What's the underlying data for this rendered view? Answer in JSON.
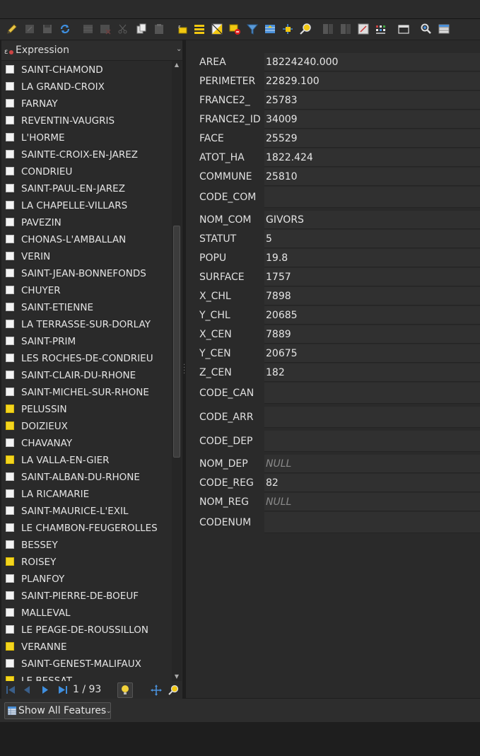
{
  "expression_header": {
    "label": "Expression"
  },
  "toolbar": {
    "icons": [
      "pencil-icon",
      "save-edits-icon",
      "save-icon",
      "reload-icon",
      "add-feature-icon",
      "delete-feature-icon",
      "cut-icon",
      "copy-icon",
      "paste-icon",
      "select-by-expression-icon",
      "select-all-icon",
      "invert-selection-icon",
      "deselect-icon",
      "filter-icon",
      "move-selection-top-icon",
      "pan-to-selection-icon",
      "zoom-to-selection-icon",
      "new-field-icon",
      "delete-field-icon",
      "field-calculator-icon",
      "conditional-formatting-icon",
      "dock-icon",
      "actions-icon",
      "table-view-icon"
    ]
  },
  "features": [
    {
      "name": "SAINT-CHAMOND",
      "selected": false
    },
    {
      "name": "LA GRAND-CROIX",
      "selected": false
    },
    {
      "name": "FARNAY",
      "selected": false
    },
    {
      "name": "REVENTIN-VAUGRIS",
      "selected": false
    },
    {
      "name": "L'HORME",
      "selected": false
    },
    {
      "name": "SAINTE-CROIX-EN-JAREZ",
      "selected": false
    },
    {
      "name": "CONDRIEU",
      "selected": false
    },
    {
      "name": "SAINT-PAUL-EN-JAREZ",
      "selected": false
    },
    {
      "name": "LA CHAPELLE-VILLARS",
      "selected": false
    },
    {
      "name": "PAVEZIN",
      "selected": false
    },
    {
      "name": "CHONAS-L'AMBALLAN",
      "selected": false
    },
    {
      "name": "VERIN",
      "selected": false
    },
    {
      "name": "SAINT-JEAN-BONNEFONDS",
      "selected": false
    },
    {
      "name": "CHUYER",
      "selected": false
    },
    {
      "name": "SAINT-ETIENNE",
      "selected": false
    },
    {
      "name": "LA TERRASSE-SUR-DORLAY",
      "selected": false
    },
    {
      "name": "SAINT-PRIM",
      "selected": false
    },
    {
      "name": "LES ROCHES-DE-CONDRIEU",
      "selected": false
    },
    {
      "name": "SAINT-CLAIR-DU-RHONE",
      "selected": false
    },
    {
      "name": "SAINT-MICHEL-SUR-RHONE",
      "selected": false
    },
    {
      "name": "PELUSSIN",
      "selected": true
    },
    {
      "name": "DOIZIEUX",
      "selected": true
    },
    {
      "name": "CHAVANAY",
      "selected": false
    },
    {
      "name": "LA VALLA-EN-GIER",
      "selected": true
    },
    {
      "name": "SAINT-ALBAN-DU-RHONE",
      "selected": false
    },
    {
      "name": "LA RICAMARIE",
      "selected": false
    },
    {
      "name": "SAINT-MAURICE-L'EXIL",
      "selected": false
    },
    {
      "name": "LE CHAMBON-FEUGEROLLES",
      "selected": false
    },
    {
      "name": "BESSEY",
      "selected": false
    },
    {
      "name": "ROISEY",
      "selected": true
    },
    {
      "name": "PLANFOY",
      "selected": false
    },
    {
      "name": "SAINT-PIERRE-DE-BOEUF",
      "selected": false
    },
    {
      "name": "MALLEVAL",
      "selected": false
    },
    {
      "name": "LE PEAGE-DE-ROUSSILLON",
      "selected": false
    },
    {
      "name": "VERANNE",
      "selected": true
    },
    {
      "name": "SAINT-GENEST-MALIFAUX",
      "selected": false
    },
    {
      "name": "LE BESSAT",
      "selected": true
    }
  ],
  "navigation": {
    "page_indicator": "1 / 93"
  },
  "attributes": [
    {
      "label": "AREA",
      "value": "18224240.000"
    },
    {
      "label": "PERIMETER",
      "value": "22829.100"
    },
    {
      "label": "FRANCE2_",
      "value": "25783"
    },
    {
      "label": "FRANCE2_ID",
      "value": "34009"
    },
    {
      "label": "FACE",
      "value": "25529"
    },
    {
      "label": "ATOT_HA",
      "value": "1822.424"
    },
    {
      "label": "COMMUNE",
      "value": "25810"
    },
    {
      "label": "CODE_COM",
      "value": ""
    },
    {
      "label": "NOM_COM",
      "value": "GIVORS"
    },
    {
      "label": "STATUT",
      "value": "5"
    },
    {
      "label": "POPU",
      "value": "19.8"
    },
    {
      "label": "SURFACE",
      "value": "1757"
    },
    {
      "label": "X_CHL",
      "value": "7898"
    },
    {
      "label": "Y_CHL",
      "value": "20685"
    },
    {
      "label": "X_CEN",
      "value": "7889"
    },
    {
      "label": "Y_CEN",
      "value": "20675"
    },
    {
      "label": "Z_CEN",
      "value": "182"
    },
    {
      "label": "CODE_CAN",
      "value": ""
    },
    {
      "label": "CODE_ARR",
      "value": ""
    },
    {
      "label": "CODE_DEP",
      "value": ""
    },
    {
      "label": "NOM_DEP",
      "value": "NULL",
      "null": true
    },
    {
      "label": "CODE_REG",
      "value": "82"
    },
    {
      "label": "NOM_REG",
      "value": "NULL",
      "null": true
    },
    {
      "label": "CODENUM",
      "value": ""
    }
  ],
  "bottom": {
    "show_all_label": "Show All Features"
  },
  "colors": {
    "selected": "#f3d51f",
    "background": "#2a2a2a",
    "accent": "#4a90d9"
  }
}
